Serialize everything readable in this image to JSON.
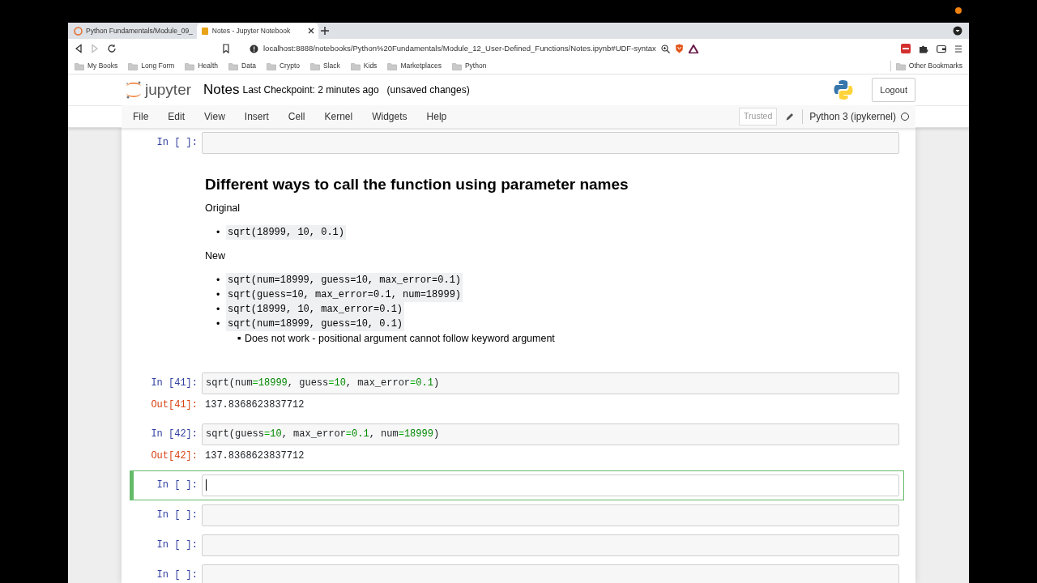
{
  "browser": {
    "tabs": [
      {
        "title": "Python Fundamentals/Module_09_",
        "selected": false
      },
      {
        "title": "Notes - Jupyter Notebook",
        "selected": true
      }
    ],
    "url": "localhost:8888/notebooks/Python%20Fundamentals/Module_12_User-Defined_Functions/Notes.ipynb#UDF-syntax",
    "bookmarks": [
      "My Books",
      "Long Form",
      "Health",
      "Data",
      "Crypto",
      "Slack",
      "Kids",
      "Marketplaces",
      "Python"
    ],
    "other_bookmarks": "Other Bookmarks"
  },
  "jupyter": {
    "logo_text": "jupyter",
    "notebook_name": "Notes",
    "checkpoint": "Last Checkpoint: 2 minutes ago",
    "unsaved": "(unsaved changes)",
    "logout": "Logout",
    "menu": [
      "File",
      "Edit",
      "View",
      "Insert",
      "Cell",
      "Kernel",
      "Widgets",
      "Help"
    ],
    "trusted": "Trusted",
    "kernel": "Python 3 (ipykernel)",
    "kernel_busy": false
  },
  "cells": [
    {
      "kind": "code",
      "prompt": "In [ ]:",
      "selected": false
    },
    {
      "kind": "markdown",
      "selected": false,
      "heading": "Different ways to call the function using parameter names",
      "blocks": [
        {
          "kind": "paragraph",
          "text": "Original"
        },
        {
          "kind": "list",
          "items": [
            {
              "marker": "•",
              "code": "sqrt(18999, 10, 0.1)"
            }
          ]
        },
        {
          "kind": "paragraph",
          "text": "New"
        },
        {
          "kind": "list",
          "items": [
            {
              "marker": "•",
              "code": "sqrt(num=18999, guess=10, max_error=0.1)"
            },
            {
              "marker": "•",
              "code": "sqrt(guess=10, max_error=0.1, num=18999)"
            },
            {
              "marker": "•",
              "code": "sqrt(18999, 10, max_error=0.1)"
            },
            {
              "marker": "•",
              "code": "sqrt(num=18999, guess=10, 0.1)",
              "children": [
                {
                  "marker": "■",
                  "text": "Does not work - positional argument cannot follow keyword argument"
                }
              ]
            }
          ]
        }
      ]
    },
    {
      "kind": "code",
      "prompt": "In [41]:",
      "selected": false,
      "code": [
        {
          "text": "sqrt(num",
          "kind": "plain"
        },
        {
          "text": "=",
          "kind": "op"
        },
        {
          "text": "18999",
          "kind": "num"
        },
        {
          "text": ", guess",
          "kind": "plain"
        },
        {
          "text": "=",
          "kind": "op"
        },
        {
          "text": "10",
          "kind": "num"
        },
        {
          "text": ", max_error",
          "kind": "plain"
        },
        {
          "text": "=",
          "kind": "op"
        },
        {
          "text": "0.1",
          "kind": "num"
        },
        {
          "text": ")",
          "kind": "plain"
        }
      ],
      "output": {
        "prompt": "Out[41]:",
        "text": "137.8368623837712"
      }
    },
    {
      "kind": "code",
      "prompt": "In [42]:",
      "selected": false,
      "code": [
        {
          "text": "sqrt(guess",
          "kind": "plain"
        },
        {
          "text": "=",
          "kind": "op"
        },
        {
          "text": "10",
          "kind": "num"
        },
        {
          "text": ", max_error",
          "kind": "plain"
        },
        {
          "text": "=",
          "kind": "op"
        },
        {
          "text": "0.1",
          "kind": "num"
        },
        {
          "text": ", num",
          "kind": "plain"
        },
        {
          "text": "=",
          "kind": "op"
        },
        {
          "text": "18999",
          "kind": "num"
        },
        {
          "text": ")",
          "kind": "plain"
        }
      ],
      "output": {
        "prompt": "Out[42]:",
        "text": "137.8368623837712"
      }
    },
    {
      "kind": "code",
      "prompt": "In [ ]:",
      "selected": true
    },
    {
      "kind": "code",
      "prompt": "In [ ]:",
      "selected": false
    },
    {
      "kind": "code",
      "prompt": "In [ ]:",
      "selected": false
    },
    {
      "kind": "code",
      "prompt": "In [ ]:",
      "selected": false
    }
  ]
}
